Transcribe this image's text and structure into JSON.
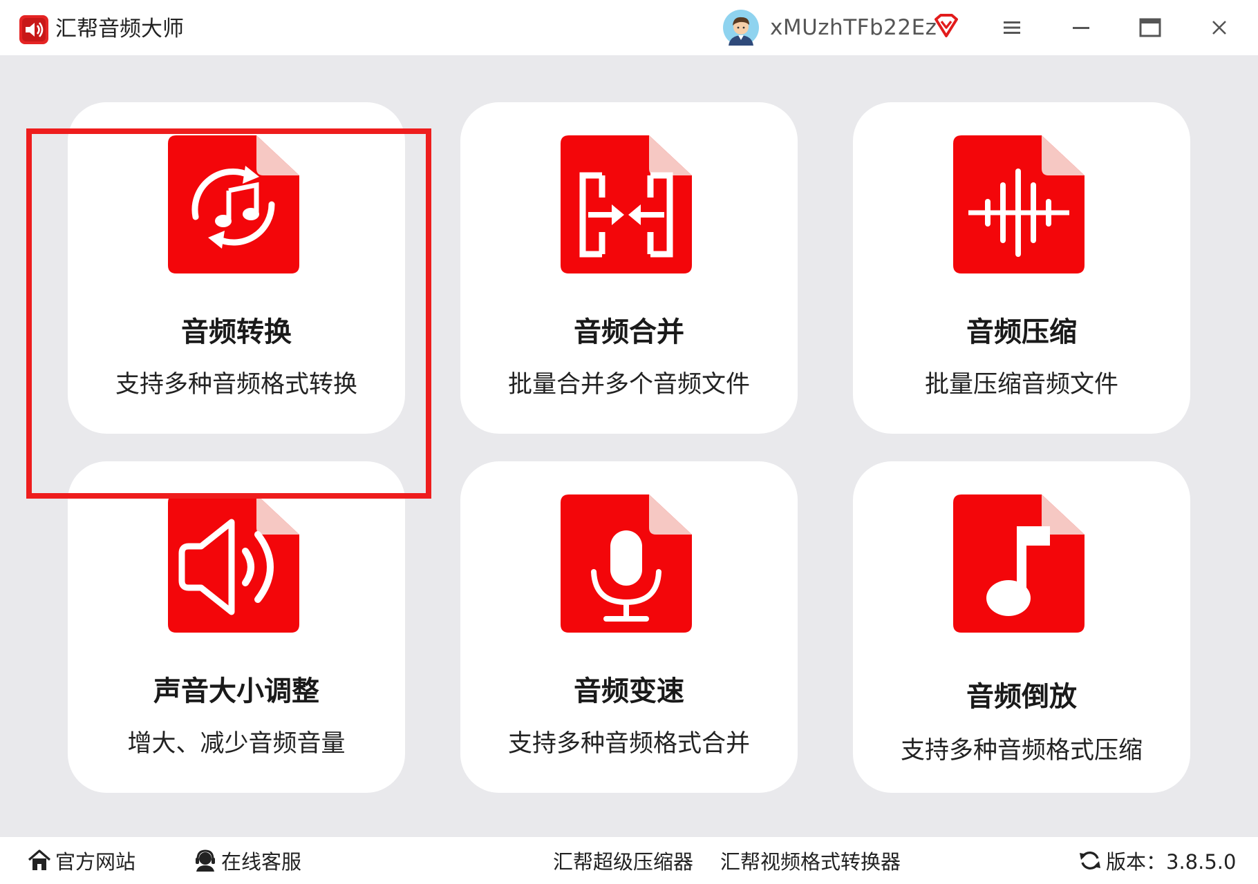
{
  "app": {
    "title": "汇帮音频大师",
    "username": "xMUzhTFb22Ez"
  },
  "colors": {
    "accent": "#ee1d1d",
    "card_bg": "#ffffff",
    "background": "#e9e9ec"
  },
  "window_controls": [
    "menu-icon",
    "minimize-icon",
    "maximize-icon",
    "close-icon"
  ],
  "tools": [
    {
      "title": "音频转换",
      "desc": "支持多种音频格式转换",
      "icon": "audio-convert-icon",
      "selected": true
    },
    {
      "title": "音频合并",
      "desc": "批量合并多个音频文件",
      "icon": "audio-merge-icon",
      "selected": false
    },
    {
      "title": "音频压缩",
      "desc": "批量压缩音频文件",
      "icon": "audio-compress-icon",
      "selected": false
    },
    {
      "title": "声音大小调整",
      "desc": "增大、减少音频音量",
      "icon": "volume-adjust-icon",
      "selected": false
    },
    {
      "title": "音频变速",
      "desc": "支持多种音频格式合并",
      "icon": "microphone-icon",
      "selected": false
    },
    {
      "title": "音频倒放",
      "desc": "支持多种音频格式压缩",
      "icon": "music-note-icon",
      "selected": false
    }
  ],
  "footer": {
    "website": "官方网站",
    "support": "在线客服",
    "compressor": "汇帮超级压缩器",
    "video_converter": "汇帮视频格式转换器",
    "version": "版本：3.8.5.0"
  }
}
